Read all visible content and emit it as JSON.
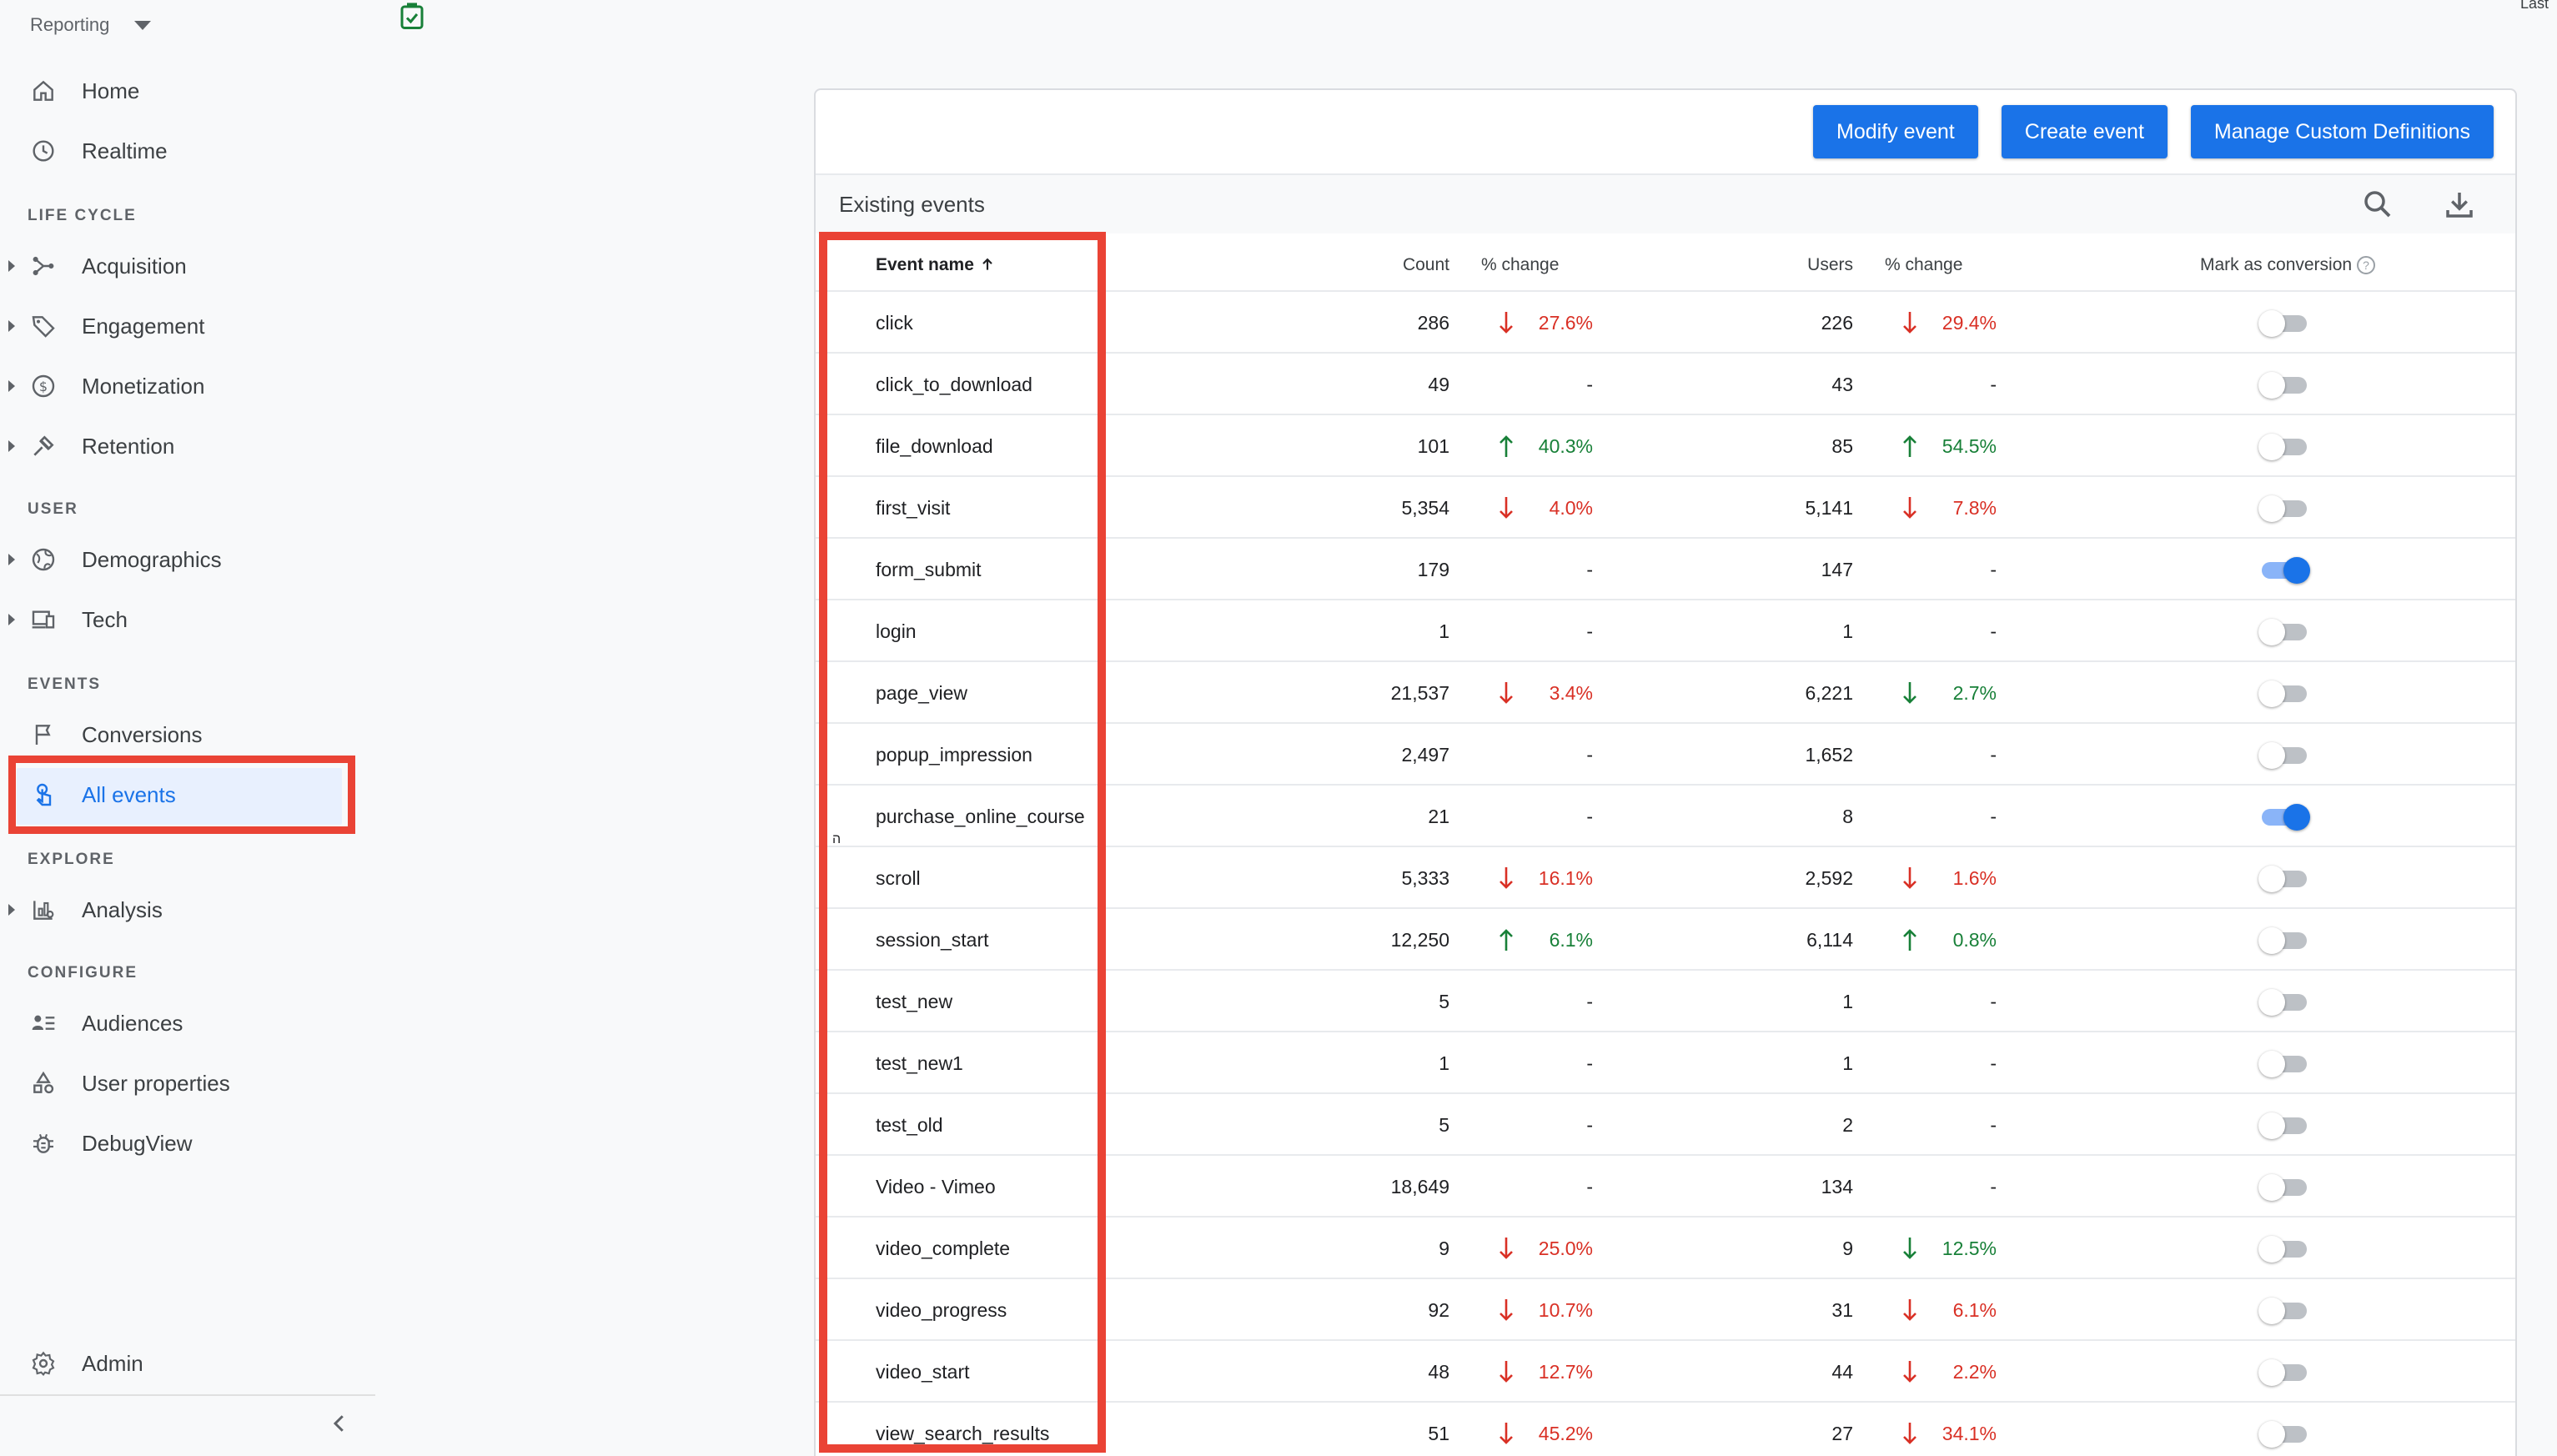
{
  "sidebar": {
    "header": "Reporting",
    "items": {
      "home": "Home",
      "realtime": "Realtime",
      "acquisition": "Acquisition",
      "engagement": "Engagement",
      "monetization": "Monetization",
      "retention": "Retention",
      "demographics": "Demographics",
      "tech": "Tech",
      "conversions": "Conversions",
      "all_events": "All events",
      "analysis": "Analysis",
      "audiences": "Audiences",
      "user_properties": "User properties",
      "debugview": "DebugView",
      "admin": "Admin"
    },
    "sections": {
      "life_cycle": "LIFE CYCLE",
      "user": "USER",
      "events": "EVENTS",
      "explore": "EXPLORE",
      "configure": "CONFIGURE"
    }
  },
  "topbar": {
    "last_text": "Last"
  },
  "card": {
    "buttons": {
      "modify": "Modify event",
      "create": "Create event",
      "manage": "Manage Custom Definitions"
    },
    "title": "Existing events",
    "columns": {
      "event_name": "Event name",
      "count": "Count",
      "count_change": "% change",
      "users": "Users",
      "users_change": "% change",
      "conversion": "Mark as conversion"
    }
  },
  "colors": {
    "accent": "#1a73e8",
    "negative": "#d93025",
    "positive": "#188038",
    "highlight": "#ea4335"
  },
  "events": [
    {
      "name": "click",
      "count": "286",
      "count_dir": "down",
      "count_change": "27.6%",
      "users": "226",
      "users_dir": "down",
      "users_change": "29.4%",
      "conversion": false
    },
    {
      "name": "click_to_download",
      "count": "49",
      "count_dir": "none",
      "count_change": "-",
      "users": "43",
      "users_dir": "none",
      "users_change": "-",
      "conversion": false
    },
    {
      "name": "file_download",
      "count": "101",
      "count_dir": "up",
      "count_change": "40.3%",
      "users": "85",
      "users_dir": "up",
      "users_change": "54.5%",
      "conversion": false
    },
    {
      "name": "first_visit",
      "count": "5,354",
      "count_dir": "down",
      "count_change": "4.0%",
      "users": "5,141",
      "users_dir": "down",
      "users_change": "7.8%",
      "conversion": false
    },
    {
      "name": "form_submit",
      "count": "179",
      "count_dir": "none",
      "count_change": "-",
      "users": "147",
      "users_dir": "none",
      "users_change": "-",
      "conversion": true
    },
    {
      "name": "login",
      "count": "1",
      "count_dir": "none",
      "count_change": "-",
      "users": "1",
      "users_dir": "none",
      "users_change": "-",
      "conversion": false
    },
    {
      "name": "page_view",
      "count": "21,537",
      "count_dir": "down",
      "count_change": "3.4%",
      "users": "6,221",
      "users_dir": "down-green",
      "users_change": "2.7%",
      "conversion": false
    },
    {
      "name": "popup_impression",
      "count": "2,497",
      "count_dir": "none",
      "count_change": "-",
      "users": "1,652",
      "users_dir": "none",
      "users_change": "-",
      "conversion": false
    },
    {
      "name": "purchase_online_course",
      "count": "21",
      "count_dir": "none",
      "count_change": "-",
      "users": "8",
      "users_dir": "none",
      "users_change": "-",
      "conversion": true
    },
    {
      "name": "scroll",
      "count": "5,333",
      "count_dir": "down",
      "count_change": "16.1%",
      "users": "2,592",
      "users_dir": "down",
      "users_change": "1.6%",
      "conversion": false
    },
    {
      "name": "session_start",
      "count": "12,250",
      "count_dir": "up",
      "count_change": "6.1%",
      "users": "6,114",
      "users_dir": "up",
      "users_change": "0.8%",
      "conversion": false
    },
    {
      "name": "test_new",
      "count": "5",
      "count_dir": "none",
      "count_change": "-",
      "users": "1",
      "users_dir": "none",
      "users_change": "-",
      "conversion": false
    },
    {
      "name": "test_new1",
      "count": "1",
      "count_dir": "none",
      "count_change": "-",
      "users": "1",
      "users_dir": "none",
      "users_change": "-",
      "conversion": false
    },
    {
      "name": "test_old",
      "count": "5",
      "count_dir": "none",
      "count_change": "-",
      "users": "2",
      "users_dir": "none",
      "users_change": "-",
      "conversion": false
    },
    {
      "name": "Video - Vimeo",
      "count": "18,649",
      "count_dir": "none",
      "count_change": "-",
      "users": "134",
      "users_dir": "none",
      "users_change": "-",
      "conversion": false
    },
    {
      "name": "video_complete",
      "count": "9",
      "count_dir": "down",
      "count_change": "25.0%",
      "users": "9",
      "users_dir": "down-green",
      "users_change": "12.5%",
      "conversion": false
    },
    {
      "name": "video_progress",
      "count": "92",
      "count_dir": "down",
      "count_change": "10.7%",
      "users": "31",
      "users_dir": "down",
      "users_change": "6.1%",
      "conversion": false
    },
    {
      "name": "video_start",
      "count": "48",
      "count_dir": "down",
      "count_change": "12.7%",
      "users": "44",
      "users_dir": "down",
      "users_change": "2.2%",
      "conversion": false
    },
    {
      "name": "view_search_results",
      "count": "51",
      "count_dir": "down",
      "count_change": "45.2%",
      "users": "27",
      "users_dir": "down",
      "users_change": "34.1%",
      "conversion": false
    }
  ]
}
